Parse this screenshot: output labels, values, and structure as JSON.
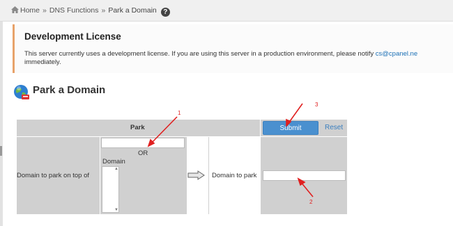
{
  "breadcrumb": {
    "items": [
      "Home",
      "DNS Functions",
      "Park a Domain"
    ],
    "separator": "»",
    "help_label": "?"
  },
  "alert": {
    "title": "Development License",
    "text_line1": "This server currently uses a development license. If you are using this server in a production environment, please notify",
    "email": "cs@cpanel.ne",
    "text_line2": "immediately."
  },
  "section": {
    "title": "Park a Domain",
    "icon": "globe-icon"
  },
  "form": {
    "header_label": "Park",
    "submit_label": "Submit",
    "reset_label": "Reset",
    "or_label": "OR",
    "domain_list_label": "Domain",
    "park_on_top_label": "Domain to park on top of",
    "domain_to_park_label": "Domain to park",
    "domain_input_value": "",
    "park_input_value": ""
  },
  "annotations": [
    "1",
    "2",
    "3"
  ],
  "colors": {
    "accent": "#4a90cf",
    "alert_border": "#e8a26a",
    "annotation": "#e02020",
    "cell_gray": "#d0d0d0"
  }
}
